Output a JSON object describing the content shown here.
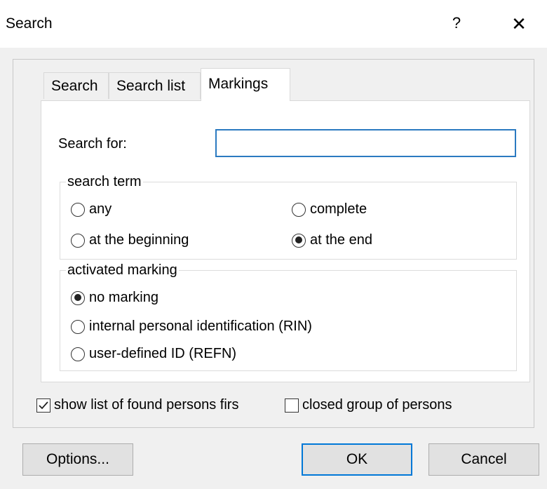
{
  "window": {
    "title": "Search",
    "help_label": "?",
    "close_label": "✕"
  },
  "tabs": [
    {
      "label": "Search"
    },
    {
      "label": "Search list"
    },
    {
      "label": "Markings"
    }
  ],
  "search_for": {
    "label": "Search for:",
    "value": "",
    "placeholder": ""
  },
  "search_term_group": {
    "legend": "search term",
    "options": [
      {
        "label": "any",
        "checked": false
      },
      {
        "label": "complete",
        "checked": false
      },
      {
        "label": "at the beginning",
        "checked": false
      },
      {
        "label": "at the end",
        "checked": true
      }
    ]
  },
  "marking_group": {
    "legend": "activated marking",
    "options": [
      {
        "label": "no marking",
        "checked": true
      },
      {
        "label": "internal personal identification (RIN)",
        "checked": false
      },
      {
        "label": "user-defined ID (REFN)",
        "checked": false
      }
    ]
  },
  "checkboxes": [
    {
      "label": "show list of found persons firs",
      "checked": true
    },
    {
      "label": "closed group of persons",
      "checked": false
    }
  ],
  "buttons": {
    "options": "Options...",
    "ok": "OK",
    "cancel": "Cancel"
  },
  "colors": {
    "focus_border": "#2b7ac1",
    "default_button_border": "#0078d7"
  }
}
